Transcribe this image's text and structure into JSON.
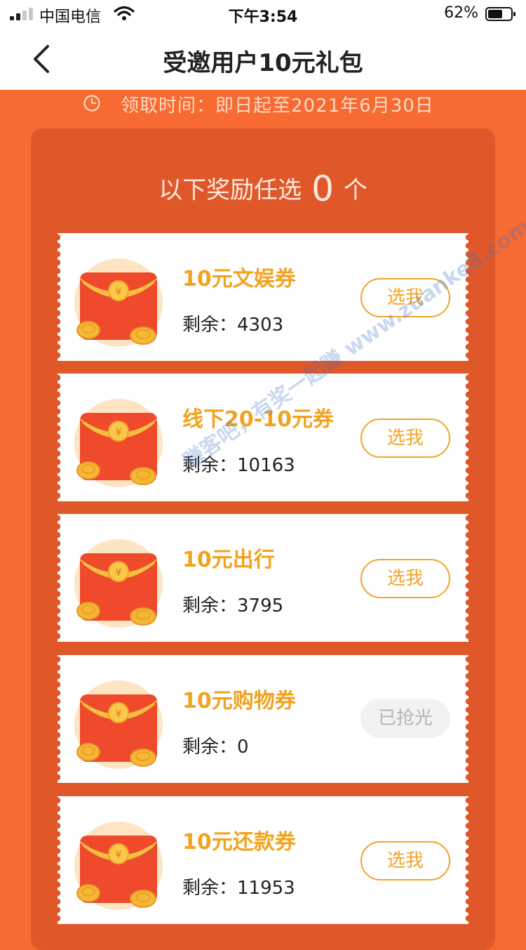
{
  "status_bar": {
    "carrier": "中国电信",
    "time": "下午3:54",
    "battery": "62%"
  },
  "nav": {
    "title": "受邀用户10元礼包"
  },
  "claim_time": "领取时间：即日起至2021年6月30日",
  "pick": {
    "prefix": "以下奖励任选",
    "count": "0",
    "suffix": "个"
  },
  "cards": [
    {
      "title": "10元文娱券",
      "remain_label": "剩余：",
      "remain": "4303",
      "button": "选我",
      "sold_out": false
    },
    {
      "title": "线下20-10元券",
      "remain_label": "剩余：",
      "remain": "10163",
      "button": "选我",
      "sold_out": false
    },
    {
      "title": "10元出行",
      "remain_label": "剩余：",
      "remain": "3795",
      "button": "选我",
      "sold_out": false
    },
    {
      "title": "10元购物券",
      "remain_label": "剩余：",
      "remain": "0",
      "button": "已抢光",
      "sold_out": true
    },
    {
      "title": "10元还款券",
      "remain_label": "剩余：",
      "remain": "11953",
      "button": "选我",
      "sold_out": false
    }
  ],
  "watermark": "赚客吧，有奖一起赚 www.zuanke8.com",
  "colors": {
    "page_bg": "#f76a32",
    "panel_bg": "#e0582a",
    "accent": "#f2a31e"
  }
}
